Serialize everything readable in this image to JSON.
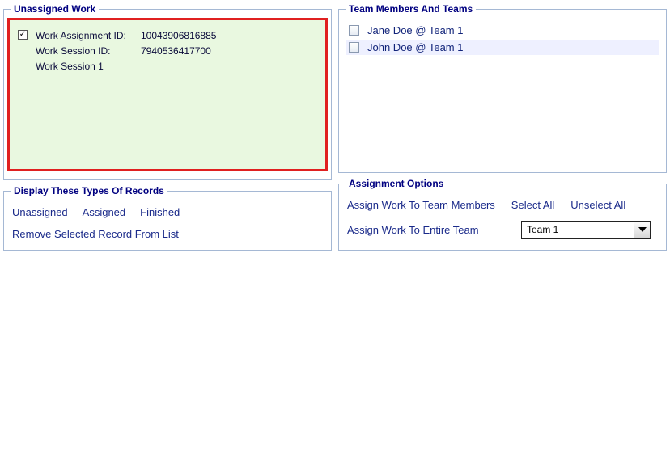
{
  "left": {
    "unassigned": {
      "legend": "Unassigned Work",
      "item": {
        "checked_glyph": "✓",
        "assignment_label": "Work Assignment ID:",
        "assignment_value": "10043906816885",
        "session_label": "Work Session ID:",
        "session_value": "7940536417700",
        "session_name": "Work Session 1"
      }
    },
    "records": {
      "legend": "Display These Types Of Records",
      "links": {
        "unassigned": "Unassigned",
        "assigned": "Assigned",
        "finished": "Finished",
        "remove": "Remove Selected Record From List"
      }
    }
  },
  "right": {
    "team": {
      "legend": "Team Members And Teams",
      "members": [
        {
          "label": "Jane Doe @ Team 1"
        },
        {
          "label": "John Doe @ Team 1"
        }
      ]
    },
    "assign": {
      "legend": "Assignment Options",
      "to_members": "Assign Work To Team Members",
      "select_all": "Select All",
      "unselect_all": "Unselect All",
      "to_team": "Assign Work To Entire Team",
      "team_selected": "Team 1"
    }
  }
}
